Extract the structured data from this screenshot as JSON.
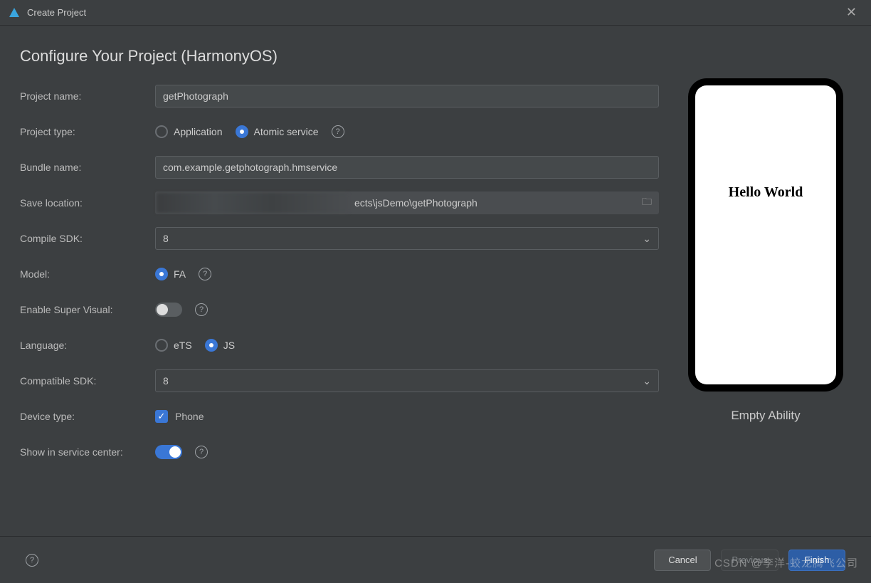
{
  "window": {
    "title": "Create Project"
  },
  "page": {
    "heading": "Configure Your Project (HarmonyOS)"
  },
  "form": {
    "projectName": {
      "label": "Project name:",
      "value": "getPhotograph"
    },
    "projectType": {
      "label": "Project type:",
      "options": {
        "application": "Application",
        "atomic": "Atomic service"
      }
    },
    "bundleName": {
      "label": "Bundle name:",
      "value": "com.example.getphotograph.hmservice"
    },
    "saveLocation": {
      "label": "Save location:",
      "valueVisible": "ects\\jsDemo\\getPhotograph"
    },
    "compileSdk": {
      "label": "Compile SDK:",
      "value": "8"
    },
    "model": {
      "label": "Model:",
      "fa": "FA"
    },
    "superVisual": {
      "label": "Enable Super Visual:"
    },
    "language": {
      "label": "Language:",
      "ets": "eTS",
      "js": "JS"
    },
    "compatibleSdk": {
      "label": "Compatible SDK:",
      "value": "8"
    },
    "deviceType": {
      "label": "Device type:",
      "phone": "Phone"
    },
    "serviceCenter": {
      "label": "Show in service center:"
    }
  },
  "preview": {
    "helloWorld": "Hello World",
    "caption": "Empty Ability"
  },
  "buttons": {
    "cancel": "Cancel",
    "previous": "Previous",
    "finish": "Finish"
  },
  "watermark": "CSDN @李洋-蛟龙腾飞公司"
}
